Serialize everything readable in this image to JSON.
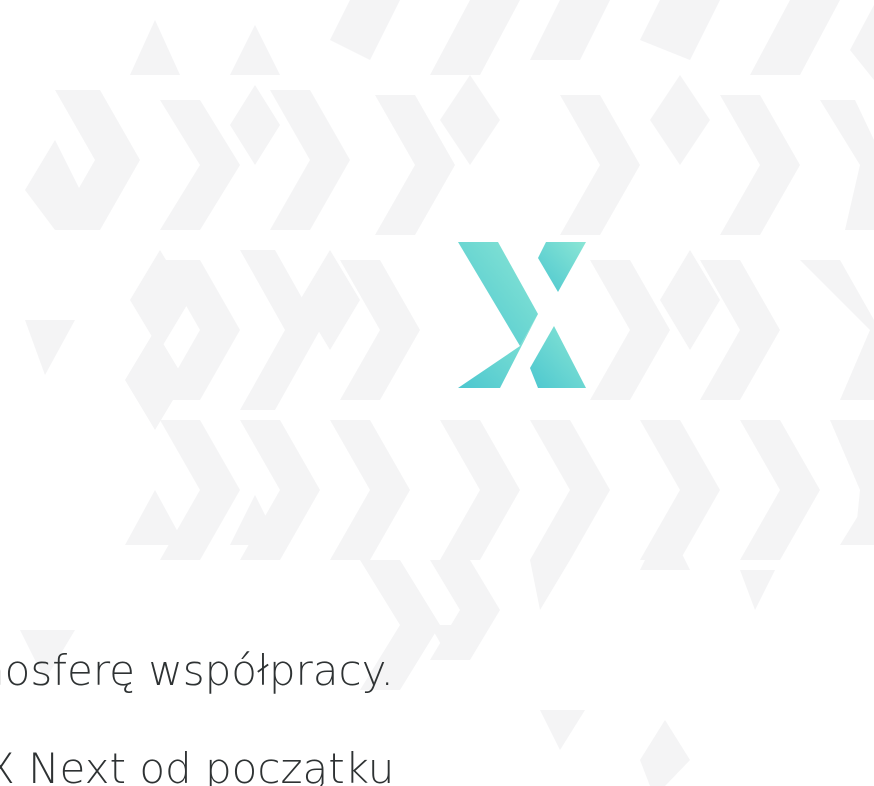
{
  "logo": {
    "icon": "x-chevron-logo-icon",
    "gradient_start": "#8be6d5",
    "gradient_end": "#4cc7cf"
  },
  "background": {
    "pattern_color": "#f4f4f5",
    "base_color": "#ffffff"
  },
  "text": {
    "line_1": "nosferę współpracy.",
    "line_2": "X Next od początku",
    "color": "#2e3233"
  }
}
